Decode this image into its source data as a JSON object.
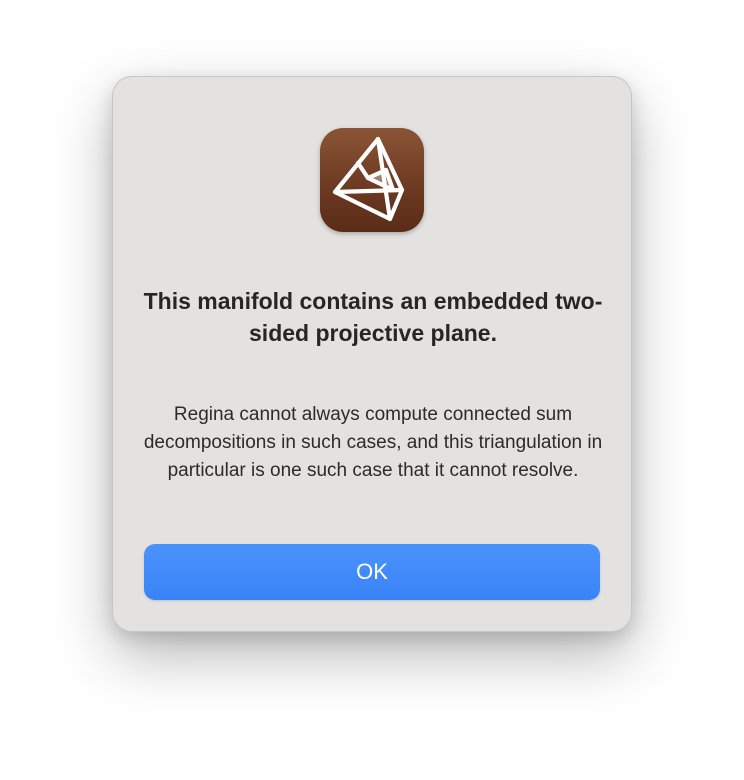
{
  "dialog": {
    "title": "This manifold contains an embedded two-sided projective plane.",
    "message": "Regina cannot always compute connected sum decompositions in such cases, and this triangulation in particular is one such case that it cannot resolve.",
    "ok_label": "OK",
    "app_icon": "regina-tetrahedron-icon"
  },
  "colors": {
    "accent": "#3b85f8",
    "dialog_background": "#e4e2e0",
    "icon_background": "#7a452b"
  }
}
